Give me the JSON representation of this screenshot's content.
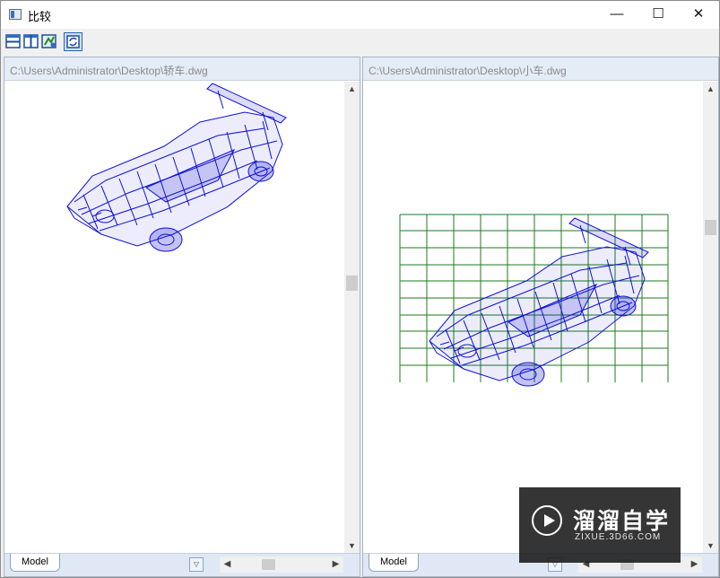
{
  "window": {
    "title": "比较",
    "controls": {
      "minimize": "—",
      "maximize": "☐",
      "close": "✕"
    }
  },
  "toolbar": {
    "buttons": [
      "split-horizontal-icon",
      "split-vertical-icon",
      "refresh-compare-icon",
      "sync-view-icon"
    ]
  },
  "left_pane": {
    "path": "C:\\Users\\Administrator\\Desktop\\轿车.dwg",
    "tab_label": "Model"
  },
  "right_pane": {
    "path": "C:\\Users\\Administrator\\Desktop\\小车.dwg",
    "tab_label": "Model"
  },
  "watermark": {
    "text": "溜溜自学",
    "subtext": "ZIXUE.3D66.COM"
  },
  "colors": {
    "wireframe": "#1010d8",
    "grid": "#1f7a1f",
    "pane_header": "#e4ecf6"
  }
}
